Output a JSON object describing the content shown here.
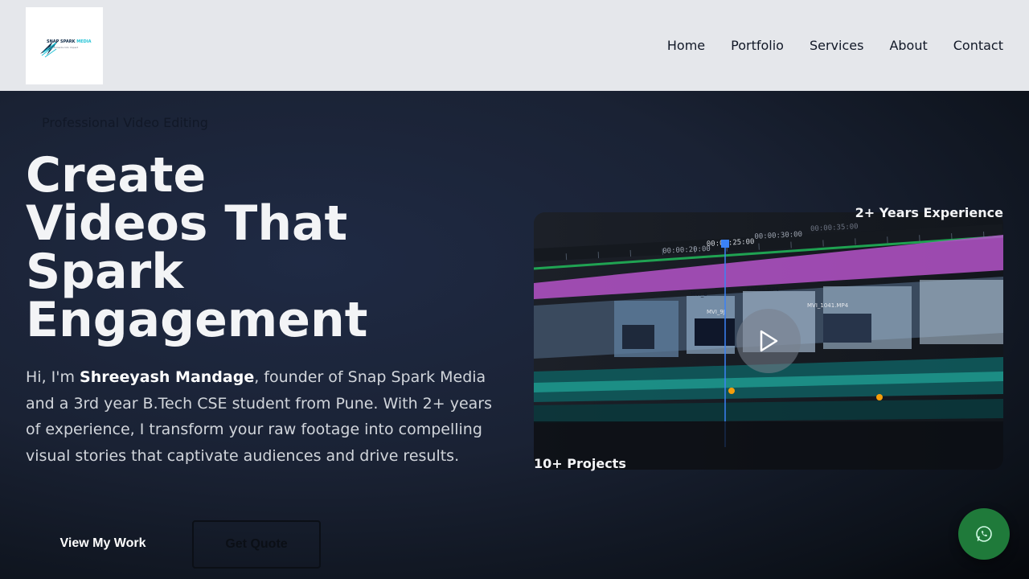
{
  "brand": {
    "logo_line1": "SNAP SPARK",
    "logo_line1_accent": "MEDIA",
    "logo_line2": "Turn Moments Into Impact"
  },
  "nav": {
    "items": [
      {
        "label": "Home"
      },
      {
        "label": "Portfolio"
      },
      {
        "label": "Services"
      },
      {
        "label": "About"
      },
      {
        "label": "Contact"
      }
    ]
  },
  "hero": {
    "tagline": "Professional Video Editing",
    "headline_lines": [
      "Create",
      "Videos That",
      "Spark",
      "Engagement"
    ],
    "intro_prefix": "Hi, I'm ",
    "intro_name": "Shreeyash Mandage",
    "intro_suffix": ", founder of Snap Spark Media and a 3rd year B.Tech CSE student from Pune. With 2+ years of experience, I transform your raw footage into compelling visual stories that captivate audiences and drive results.",
    "primary_button": "View My Work",
    "secondary_button": "Get Quote"
  },
  "video": {
    "timecodes": [
      "00:00:20:00",
      "00:00:25:00",
      "00:00:30:00",
      "00:00:35:00"
    ],
    "clip_labels": [
      "MVI_0",
      "C0086.MP4",
      "MVI_9J",
      "MVI_1041.MP4"
    ],
    "stat_experience": "2+ Years Experience",
    "stat_projects": "10+ Projects"
  },
  "icons": {
    "play": "play-icon",
    "whatsapp": "whatsapp-icon",
    "logo": "logo-icon"
  },
  "colors": {
    "header_bg": "#e5e7eb",
    "hero_bg": "#1a2234",
    "accent_teal": "#22c3d6",
    "whatsapp_green": "#1f7a3a"
  }
}
